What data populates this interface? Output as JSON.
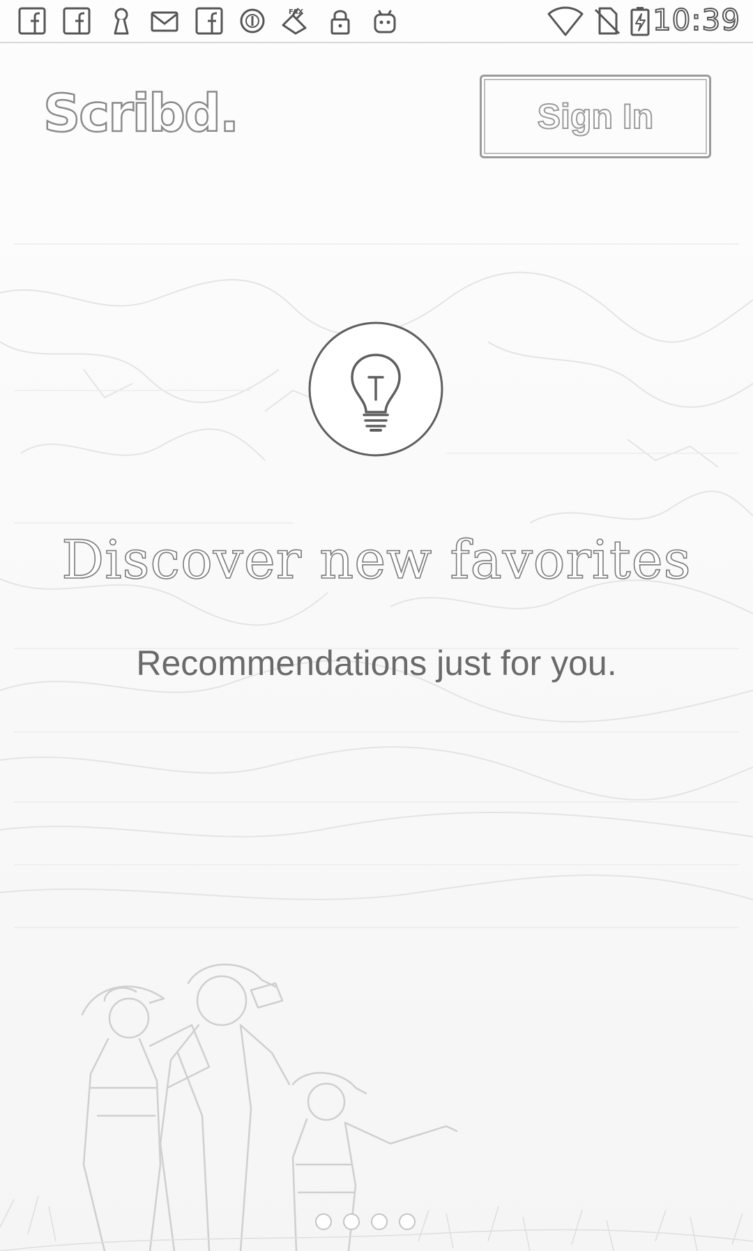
{
  "status_bar": {
    "time": "10:39",
    "notification_icons": [
      "facebook-icon",
      "facebook-icon",
      "keyhole-icon",
      "mail-icon",
      "facebook-icon",
      "circle-badge-icon",
      "fax-icon",
      "lock-icon",
      "android-icon"
    ],
    "system_icons": [
      "wifi-icon",
      "no-sim-icon",
      "battery-charging-icon"
    ]
  },
  "header": {
    "logo_text": "Scribd.",
    "sign_in_label": "Sign In"
  },
  "feature": {
    "icon": "lightbulb-icon",
    "headline": "Discover new favorites",
    "subline": "Recommendations just for you."
  },
  "pager": {
    "total": 4,
    "current": 1
  },
  "colors": {
    "outline": "#8a8a8a",
    "text": "#6a6a6a",
    "background": "#fbfbfb"
  }
}
